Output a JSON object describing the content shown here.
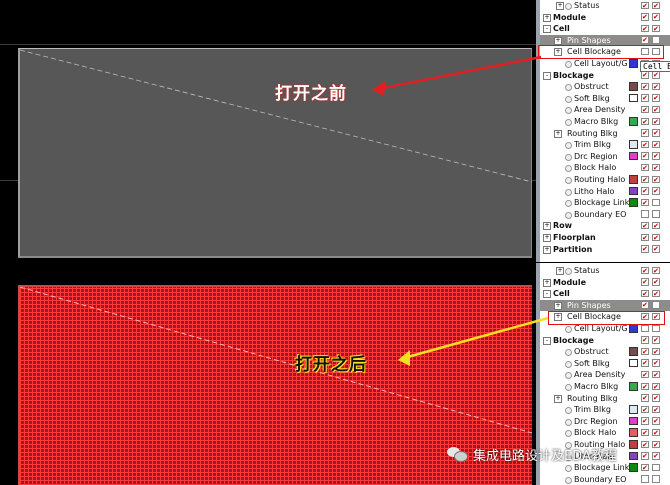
{
  "annotations": {
    "before": "打开之前",
    "after": "打开之后"
  },
  "tooltip": "Cell Bl",
  "watermark": "集成电路设计及EDA教程",
  "colors": {
    "canvas_bg": "#000000",
    "cell_box_gray": "#575757",
    "cell_blockage_fill": "#a01818",
    "highlight_row": "#8c8c8c",
    "annotation_red": "#e02020",
    "annotation_yellow": "#f5e020",
    "check_red": "#c80000"
  },
  "layer_panel_top": [
    {
      "label": "Status",
      "indent": 2,
      "expander": "+",
      "bullet": true,
      "bold": false,
      "swatch": "",
      "vis": true,
      "sel": true,
      "highlight": false
    },
    {
      "label": "Module",
      "indent": 0,
      "expander": "+",
      "bullet": false,
      "bold": true,
      "swatch": "",
      "vis": true,
      "sel": true,
      "highlight": false
    },
    {
      "label": "Cell",
      "indent": 0,
      "expander": "-",
      "bullet": false,
      "bold": true,
      "swatch": "",
      "vis": true,
      "sel": true,
      "highlight": false
    },
    {
      "label": "Pin Shapes",
      "indent": 1,
      "expander": "+",
      "bullet": false,
      "bold": false,
      "swatch": "",
      "vis": true,
      "sel": false,
      "highlight": true
    },
    {
      "label": "Cell Blockage",
      "indent": 1,
      "expander": "+",
      "bullet": false,
      "bold": false,
      "swatch": "",
      "vis": false,
      "sel": false,
      "highlight": false
    },
    {
      "label": "Cell Layout/G",
      "indent": 2,
      "expander": "",
      "bullet": true,
      "bold": false,
      "swatch": "#2d3cc8",
      "vis": false,
      "sel": false,
      "highlight": false
    },
    {
      "label": "Blockage",
      "indent": 0,
      "expander": "-",
      "bullet": false,
      "bold": true,
      "swatch": "",
      "vis": true,
      "sel": true,
      "highlight": false
    },
    {
      "label": "Obstruct",
      "indent": 2,
      "expander": "",
      "bullet": true,
      "bold": false,
      "swatch": "#7a4a4a",
      "vis": true,
      "sel": true,
      "highlight": false
    },
    {
      "label": "Soft Blkg",
      "indent": 2,
      "expander": "",
      "bullet": true,
      "bold": false,
      "swatch": "#ffffff",
      "vis": true,
      "sel": true,
      "highlight": false
    },
    {
      "label": "Area Density",
      "indent": 2,
      "expander": "",
      "bullet": true,
      "bold": false,
      "swatch": "",
      "vis": true,
      "sel": true,
      "highlight": false
    },
    {
      "label": "Macro Blkg",
      "indent": 2,
      "expander": "",
      "bullet": true,
      "bold": false,
      "swatch": "#3aa84a",
      "vis": true,
      "sel": true,
      "highlight": false
    },
    {
      "label": "Routing Blkg",
      "indent": 1,
      "expander": "+",
      "bullet": false,
      "bold": false,
      "swatch": "",
      "vis": true,
      "sel": true,
      "highlight": false
    },
    {
      "label": "Trim Blkg",
      "indent": 2,
      "expander": "",
      "bullet": true,
      "bold": false,
      "swatch": "#dde8f0",
      "vis": true,
      "sel": true,
      "highlight": false
    },
    {
      "label": "Drc Region",
      "indent": 2,
      "expander": "",
      "bullet": true,
      "bold": false,
      "swatch": "#e040c8",
      "vis": true,
      "sel": true,
      "highlight": false
    },
    {
      "label": "Block Halo",
      "indent": 2,
      "expander": "",
      "bullet": true,
      "bold": false,
      "swatch": "",
      "vis": true,
      "sel": true,
      "highlight": false
    },
    {
      "label": "Routing Halo",
      "indent": 2,
      "expander": "",
      "bullet": true,
      "bold": false,
      "swatch": "#c04040",
      "vis": true,
      "sel": true,
      "highlight": false
    },
    {
      "label": "Litho Halo",
      "indent": 2,
      "expander": "",
      "bullet": true,
      "bold": false,
      "swatch": "#8a40c0",
      "vis": true,
      "sel": true,
      "highlight": false
    },
    {
      "label": "Blockage Link",
      "indent": 2,
      "expander": "",
      "bullet": true,
      "bold": false,
      "swatch": "#0a8a10",
      "vis": true,
      "sel": false,
      "highlight": false
    },
    {
      "label": "Boundary EO",
      "indent": 2,
      "expander": "",
      "bullet": true,
      "bold": false,
      "swatch": "",
      "vis": false,
      "sel": false,
      "highlight": false
    },
    {
      "label": "Row",
      "indent": 0,
      "expander": "+",
      "bullet": false,
      "bold": true,
      "swatch": "",
      "vis": true,
      "sel": true,
      "highlight": false
    },
    {
      "label": "Floorplan",
      "indent": 0,
      "expander": "+",
      "bullet": false,
      "bold": true,
      "swatch": "",
      "vis": true,
      "sel": true,
      "highlight": false
    },
    {
      "label": "Partition",
      "indent": 0,
      "expander": "+",
      "bullet": false,
      "bold": true,
      "swatch": "",
      "vis": true,
      "sel": true,
      "highlight": false
    }
  ],
  "layer_panel_bottom": [
    {
      "label": "Status",
      "indent": 2,
      "expander": "+",
      "bullet": true,
      "bold": false,
      "swatch": "",
      "vis": true,
      "sel": true,
      "highlight": false
    },
    {
      "label": "Module",
      "indent": 0,
      "expander": "+",
      "bullet": false,
      "bold": true,
      "swatch": "",
      "vis": true,
      "sel": true,
      "highlight": false
    },
    {
      "label": "Cell",
      "indent": 0,
      "expander": "-",
      "bullet": false,
      "bold": true,
      "swatch": "",
      "vis": true,
      "sel": true,
      "highlight": false
    },
    {
      "label": "Pin Shapes",
      "indent": 1,
      "expander": "+",
      "bullet": false,
      "bold": false,
      "swatch": "",
      "vis": true,
      "sel": false,
      "highlight": true
    },
    {
      "label": "Cell Blockage",
      "indent": 1,
      "expander": "+",
      "bullet": false,
      "bold": false,
      "swatch": "",
      "vis": true,
      "sel": true,
      "highlight": false
    },
    {
      "label": "Cell Layout/G",
      "indent": 2,
      "expander": "",
      "bullet": true,
      "bold": false,
      "swatch": "#2d3cc8",
      "vis": false,
      "sel": false,
      "highlight": false
    },
    {
      "label": "Blockage",
      "indent": 0,
      "expander": "-",
      "bullet": false,
      "bold": true,
      "swatch": "",
      "vis": true,
      "sel": true,
      "highlight": false
    },
    {
      "label": "Obstruct",
      "indent": 2,
      "expander": "",
      "bullet": true,
      "bold": false,
      "swatch": "#7a4a4a",
      "vis": true,
      "sel": true,
      "highlight": false
    },
    {
      "label": "Soft Blkg",
      "indent": 2,
      "expander": "",
      "bullet": true,
      "bold": false,
      "swatch": "#ffffff",
      "vis": true,
      "sel": true,
      "highlight": false
    },
    {
      "label": "Area Density",
      "indent": 2,
      "expander": "",
      "bullet": true,
      "bold": false,
      "swatch": "",
      "vis": true,
      "sel": true,
      "highlight": false
    },
    {
      "label": "Macro Blkg",
      "indent": 2,
      "expander": "",
      "bullet": true,
      "bold": false,
      "swatch": "#3aa84a",
      "vis": true,
      "sel": true,
      "highlight": false
    },
    {
      "label": "Routing Blkg",
      "indent": 1,
      "expander": "+",
      "bullet": false,
      "bold": false,
      "swatch": "",
      "vis": true,
      "sel": true,
      "highlight": false
    },
    {
      "label": "Trim Blkg",
      "indent": 2,
      "expander": "",
      "bullet": true,
      "bold": false,
      "swatch": "#dde8f0",
      "vis": true,
      "sel": true,
      "highlight": false
    },
    {
      "label": "Drc Region",
      "indent": 2,
      "expander": "",
      "bullet": true,
      "bold": false,
      "swatch": "#e040c8",
      "vis": true,
      "sel": true,
      "highlight": false
    },
    {
      "label": "Block Halo",
      "indent": 2,
      "expander": "",
      "bullet": true,
      "bold": false,
      "swatch": "#e06060",
      "vis": true,
      "sel": true,
      "highlight": false
    },
    {
      "label": "Routing Halo",
      "indent": 2,
      "expander": "",
      "bullet": true,
      "bold": false,
      "swatch": "#c04040",
      "vis": true,
      "sel": true,
      "highlight": false
    },
    {
      "label": "Litho Halo",
      "indent": 2,
      "expander": "",
      "bullet": true,
      "bold": false,
      "swatch": "#8a40c0",
      "vis": true,
      "sel": true,
      "highlight": false
    },
    {
      "label": "Blockage Link",
      "indent": 2,
      "expander": "",
      "bullet": true,
      "bold": false,
      "swatch": "#0a8a10",
      "vis": true,
      "sel": false,
      "highlight": false
    },
    {
      "label": "Boundary EO",
      "indent": 2,
      "expander": "",
      "bullet": true,
      "bold": false,
      "swatch": "",
      "vis": false,
      "sel": false,
      "highlight": false
    }
  ]
}
